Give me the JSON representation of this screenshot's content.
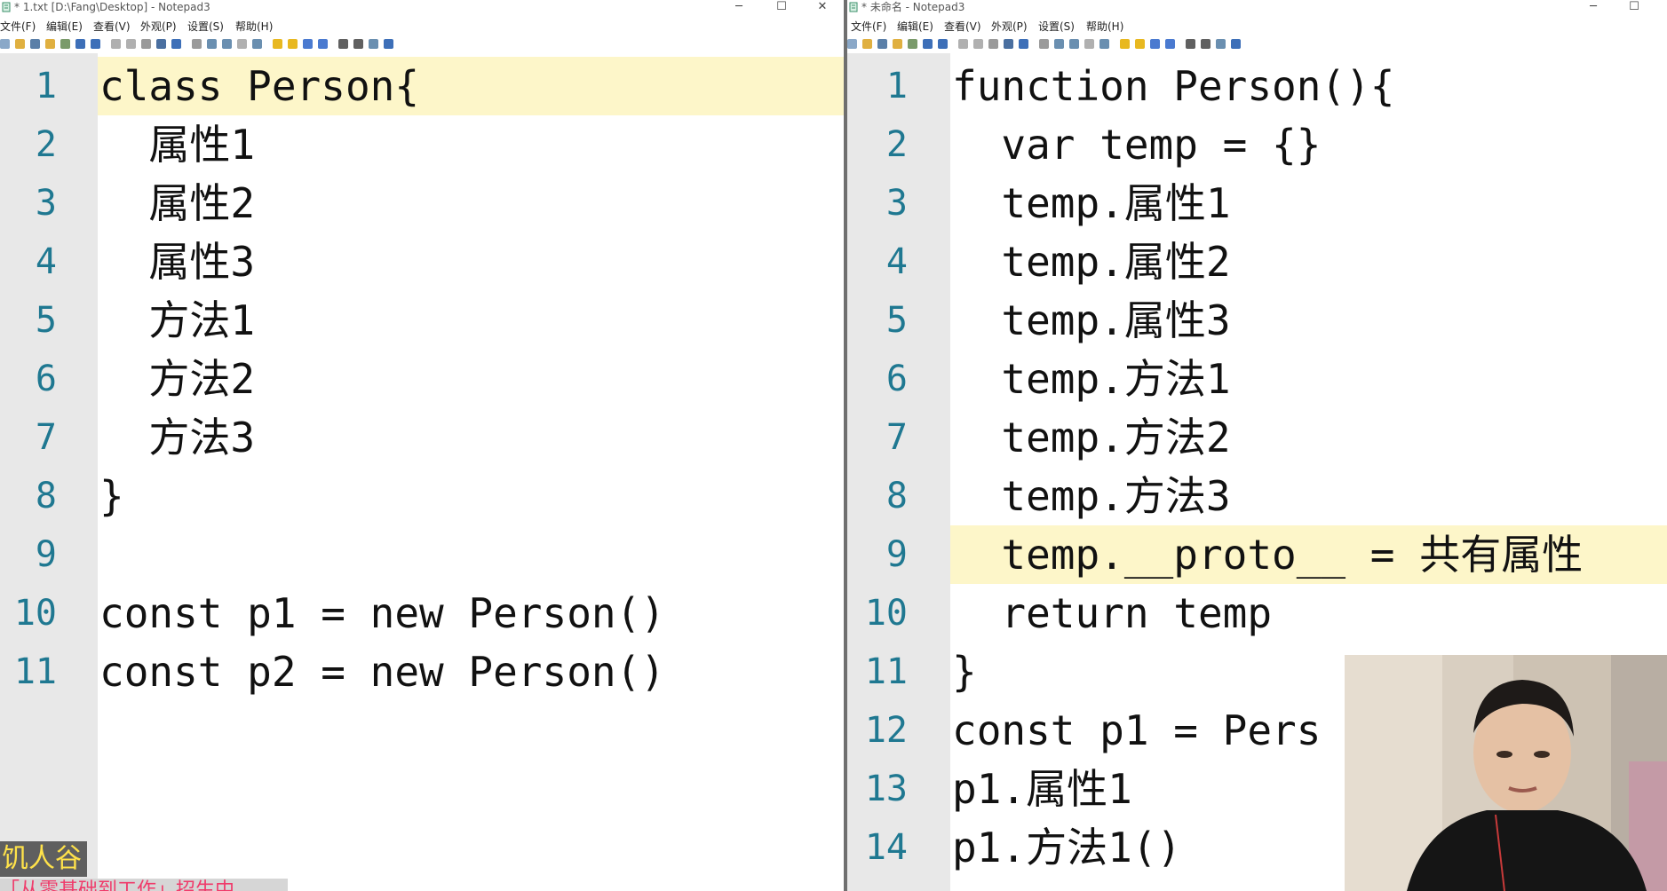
{
  "left_window": {
    "title": "* 1.txt [D:\\Fang\\Desktop] - Notepad3",
    "window_buttons": {
      "minimize": "─",
      "maximize": "☐",
      "close": "✕"
    },
    "menu": [
      "文件(F)",
      "编辑(E)",
      "查看(V)",
      "外观(P)",
      "设置(S)",
      "帮助(H)"
    ],
    "lines": [
      {
        "num": "1",
        "text": "class Person{"
      },
      {
        "num": "2",
        "text": "  属性1"
      },
      {
        "num": "3",
        "text": "  属性2"
      },
      {
        "num": "4",
        "text": "  属性3"
      },
      {
        "num": "5",
        "text": "  方法1"
      },
      {
        "num": "6",
        "text": "  方法2"
      },
      {
        "num": "7",
        "text": "  方法3"
      },
      {
        "num": "8",
        "text": "}"
      },
      {
        "num": "9",
        "text": ""
      },
      {
        "num": "10",
        "text": "const p1 = new Person()"
      },
      {
        "num": "11",
        "text": "const p2 = new Person()"
      }
    ],
    "current_line": "1"
  },
  "right_window": {
    "title": "* 未命名 - Notepad3",
    "window_buttons": {
      "minimize": "─",
      "maximize": "☐"
    },
    "menu": [
      "文件(F)",
      "编辑(E)",
      "查看(V)",
      "外观(P)",
      "设置(S)",
      "帮助(H)"
    ],
    "lines": [
      {
        "num": "1",
        "text": "function Person(){"
      },
      {
        "num": "2",
        "text": "  var temp = {}"
      },
      {
        "num": "3",
        "text": "  temp.属性1"
      },
      {
        "num": "4",
        "text": "  temp.属性2"
      },
      {
        "num": "5",
        "text": "  temp.属性3"
      },
      {
        "num": "6",
        "text": "  temp.方法1"
      },
      {
        "num": "7",
        "text": "  temp.方法2"
      },
      {
        "num": "8",
        "text": "  temp.方法3"
      },
      {
        "num": "9",
        "text": "  temp.__proto__ = 共有属性"
      },
      {
        "num": "10",
        "text": "  return temp"
      },
      {
        "num": "11",
        "text": "}"
      },
      {
        "num": "12",
        "text": "const p1 = Pers"
      },
      {
        "num": "13",
        "text": "p1.属性1"
      },
      {
        "num": "14",
        "text": "p1.方法1()"
      }
    ],
    "current_line": "9"
  },
  "overlay": {
    "watermark_top": "饥人谷",
    "watermark_bottom": "「从零基础到工作」招生中"
  },
  "colors": {
    "line_number": "#1f7891",
    "current_line_bg": "#fdf6c9",
    "gutter_bg": "#e8e8e8",
    "code_text": "#111111"
  }
}
